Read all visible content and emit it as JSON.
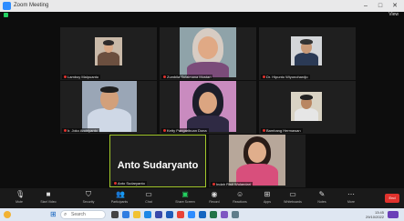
{
  "window": {
    "title": "Zoom Meeting",
    "controls": [
      "–",
      "□",
      "✕"
    ]
  },
  "security": {
    "view_label": "View"
  },
  "participants": [
    {
      "name": "Lamboy Malpuanto",
      "muted": true
    },
    {
      "name": "Zumbila Sulaimana Mustari",
      "muted": true
    },
    {
      "name": "Dr. Hipunto Wiyonohardjo",
      "muted": true
    },
    {
      "name": "Ir. Joko Andriyanto",
      "muted": true
    },
    {
      "name": "Ketty Pangaribuan Dona",
      "muted": true
    },
    {
      "name": "Bambang Hermawan",
      "muted": true
    },
    {
      "name": "Anto Sudaryanto",
      "muted": true,
      "active_speaker": true
    },
    {
      "name": "Indah Risti Wulandari",
      "muted": true
    }
  ],
  "active_speaker": {
    "display_name": "Anto Sudaryanto"
  },
  "toolbar": {
    "items": [
      {
        "label": "Mute",
        "icon": "microphone-icon"
      },
      {
        "label": "Start Video",
        "icon": "video-icon"
      },
      {
        "label": "Security",
        "icon": "shield-icon"
      },
      {
        "label": "Participants",
        "icon": "participants-icon"
      },
      {
        "label": "Chat",
        "icon": "chat-icon"
      },
      {
        "label": "Share Screen",
        "icon": "share-screen-icon"
      },
      {
        "label": "Record",
        "icon": "record-icon"
      },
      {
        "label": "Reactions",
        "icon": "reactions-icon"
      },
      {
        "label": "Apps",
        "icon": "apps-icon"
      },
      {
        "label": "Whiteboards",
        "icon": "whiteboard-icon"
      },
      {
        "label": "Notes",
        "icon": "notes-icon"
      },
      {
        "label": "More",
        "icon": "more-icon"
      }
    ],
    "end_label": "End"
  },
  "taskbar": {
    "search_placeholder": "Search",
    "time": "13:45",
    "date": "29/10/2022",
    "apps": [
      {
        "icon": "task-view-icon",
        "color": "#444444"
      },
      {
        "icon": "widgets-icon",
        "color": "#2f7de1"
      },
      {
        "icon": "file-explorer-icon",
        "color": "#f1c232"
      },
      {
        "icon": "edge-icon",
        "color": "#1e88e5"
      },
      {
        "icon": "store-icon",
        "color": "#3949ab"
      },
      {
        "icon": "word-icon",
        "color": "#1e5bb8"
      },
      {
        "icon": "chrome-icon",
        "color": "#e94235"
      },
      {
        "icon": "zoom-icon",
        "color": "#2d8cff"
      },
      {
        "icon": "mail-icon",
        "color": "#1565c0"
      },
      {
        "icon": "excel-icon",
        "color": "#217346"
      },
      {
        "icon": "photos-icon",
        "color": "#7e57c2"
      },
      {
        "icon": "settings-icon",
        "color": "#607d8b"
      }
    ]
  },
  "colors": {
    "active_border": "#a2c72b",
    "end_button": "#e0322d",
    "accent": "#2d8cff"
  }
}
